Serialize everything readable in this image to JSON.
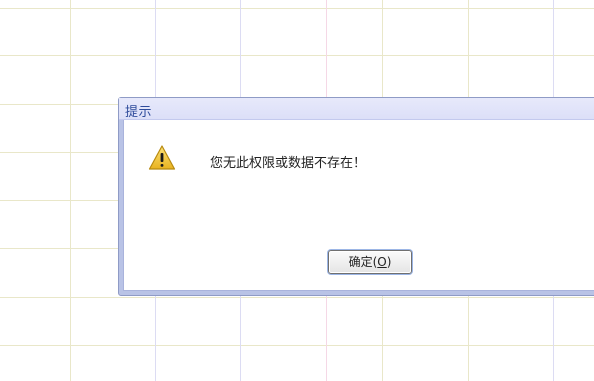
{
  "dialog": {
    "title": "提示",
    "message": "您无此权限或数据不存在！",
    "icon": "warning-icon",
    "ok_button": {
      "label": "确定(O)",
      "text_before": "确定(",
      "mnemonic": "O",
      "text_after": ")"
    }
  },
  "colors": {
    "title_text": "#2e4b9b",
    "title_bar": "#e0e3f9",
    "frame": "#b9c3e6",
    "grid_line": "#e9e7c9",
    "warning_fill": "#f2c832"
  }
}
